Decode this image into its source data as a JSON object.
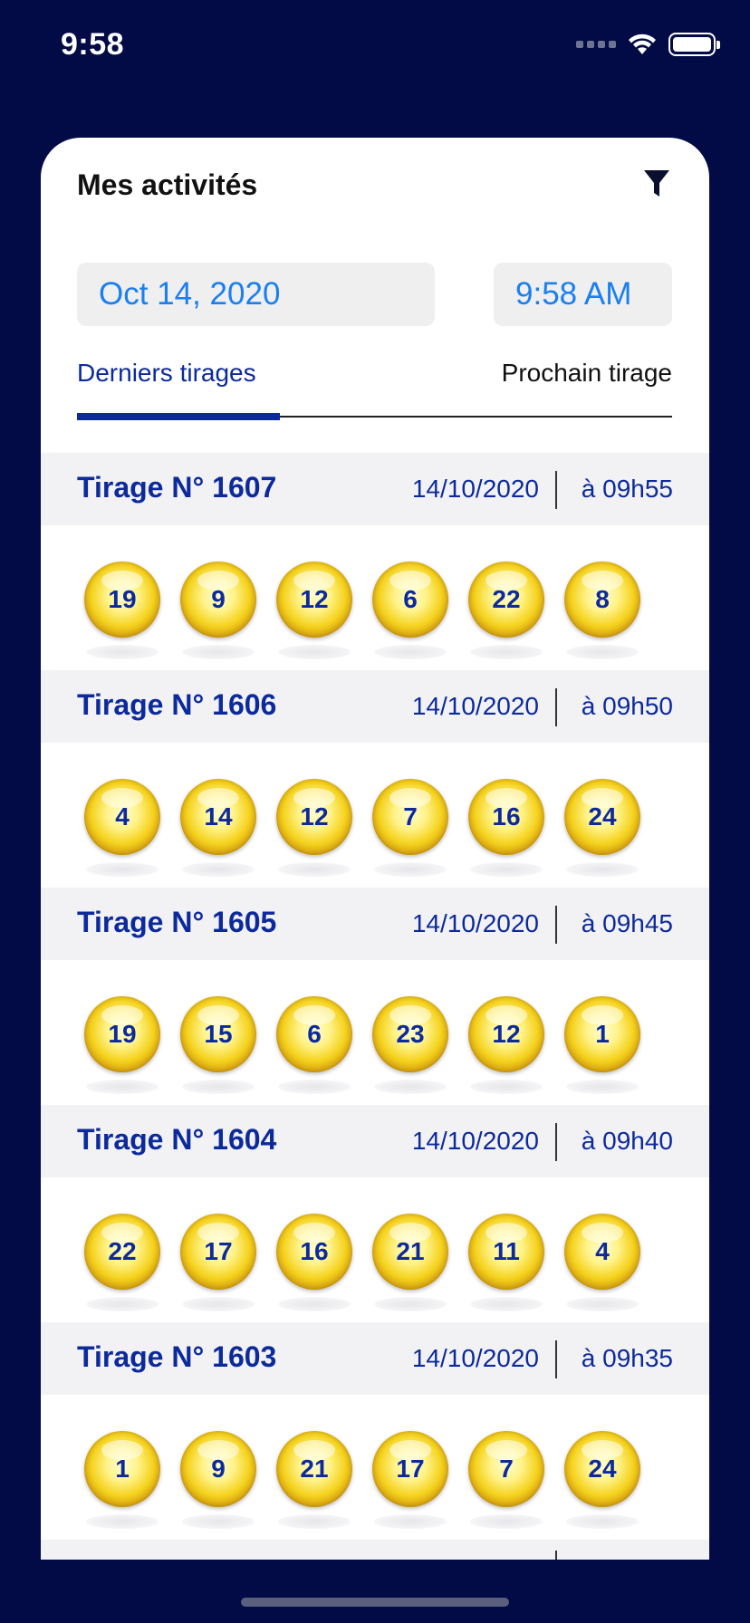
{
  "status_bar": {
    "time": "9:58"
  },
  "header": {
    "title": "Mes activités",
    "filter_icon": "filter-icon"
  },
  "pickers": {
    "date": "Oct 14, 2020",
    "time": "9:58 AM"
  },
  "tabs": [
    {
      "label": "Derniers tirages",
      "active": true
    },
    {
      "label": "Prochain tirage",
      "active": false
    }
  ],
  "colors": {
    "background": "#020b45",
    "accent": "#0c2a9c",
    "picker_text": "#1a7ff0"
  },
  "draws": [
    {
      "title": "Tirage N° 1607",
      "date": "14/10/2020",
      "time": "à 09h55",
      "numbers": [
        "19",
        "9",
        "12",
        "6",
        "22",
        "8"
      ]
    },
    {
      "title": "Tirage N° 1606",
      "date": "14/10/2020",
      "time": "à 09h50",
      "numbers": [
        "4",
        "14",
        "12",
        "7",
        "16",
        "24"
      ]
    },
    {
      "title": "Tirage N° 1605",
      "date": "14/10/2020",
      "time": "à 09h45",
      "numbers": [
        "19",
        "15",
        "6",
        "23",
        "12",
        "1"
      ]
    },
    {
      "title": "Tirage N° 1604",
      "date": "14/10/2020",
      "time": "à 09h40",
      "numbers": [
        "22",
        "17",
        "16",
        "21",
        "11",
        "4"
      ]
    },
    {
      "title": "Tirage N° 1603",
      "date": "14/10/2020",
      "time": "à 09h35",
      "numbers": [
        "1",
        "9",
        "21",
        "17",
        "7",
        "24"
      ]
    }
  ]
}
